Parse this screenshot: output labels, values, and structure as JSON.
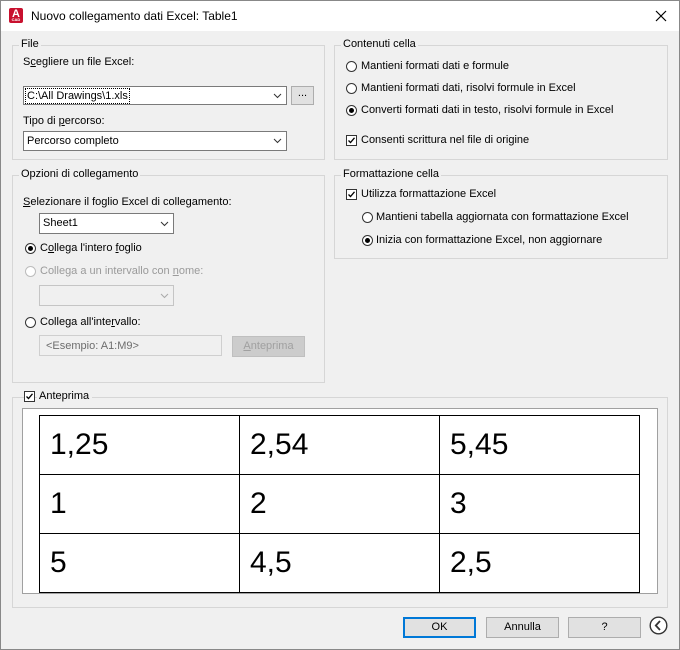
{
  "window": {
    "title": "Nuovo collegamento dati Excel: Table1",
    "icon_letter": "A",
    "icon_sub": "CAD"
  },
  "file": {
    "legend": "File",
    "choose_label_pre": "S",
    "choose_label_u": "c",
    "choose_label_post": "egliere un file Excel:",
    "file_value": "C:\\All Drawings\\1.xls",
    "browse_label": "...",
    "path_label_pre": "Tipo di ",
    "path_label_u": "p",
    "path_label_post": "ercorso:",
    "path_value": "Percorso completo"
  },
  "link": {
    "legend": "Opzioni di collegamento",
    "sheet_label_pre": "",
    "sheet_label_u": "S",
    "sheet_label_post": "elezionare il foglio Excel di collegamento:",
    "sheet_value": "Sheet1",
    "opt_whole_pre": "C",
    "opt_whole_u": "o",
    "opt_whole_post": "llega l'intero ",
    "opt_whole_u2": "f",
    "opt_whole_post2": "oglio",
    "opt_named_pre": "Collega a un intervallo con ",
    "opt_named_u": "n",
    "opt_named_post": "ome:",
    "opt_range_pre": "Collega all'inte",
    "opt_range_u": "r",
    "opt_range_post": "vallo:",
    "range_placeholder": "<Esempio: A1:M9>",
    "preview_btn_u": "A",
    "preview_btn_post": "nteprima"
  },
  "cell_contents": {
    "legend": "Contenuti cella",
    "opt1": "Mantieni formati dati e formule",
    "opt2": "Mantieni formati dati, risolvi formule in Excel",
    "opt3": "Converti formati dati in testo, risolvi formule in Excel",
    "allow_write": "Consenti scrittura nel file di origine"
  },
  "cell_format": {
    "legend": "Formattazione cella",
    "use_excel": "Utilizza formattazione Excel",
    "opt1": "Mantieni tabella aggiornata con formattazione Excel",
    "opt2": "Inizia con formattazione Excel, non aggiornare"
  },
  "preview": {
    "label": "Anteprima",
    "rows": [
      [
        "1,25",
        "2,54",
        "5,45"
      ],
      [
        "1",
        "2",
        "3"
      ],
      [
        "5",
        "4,5",
        "2,5"
      ]
    ]
  },
  "buttons": {
    "ok": "OK",
    "cancel": "Annulla",
    "help": "?"
  }
}
